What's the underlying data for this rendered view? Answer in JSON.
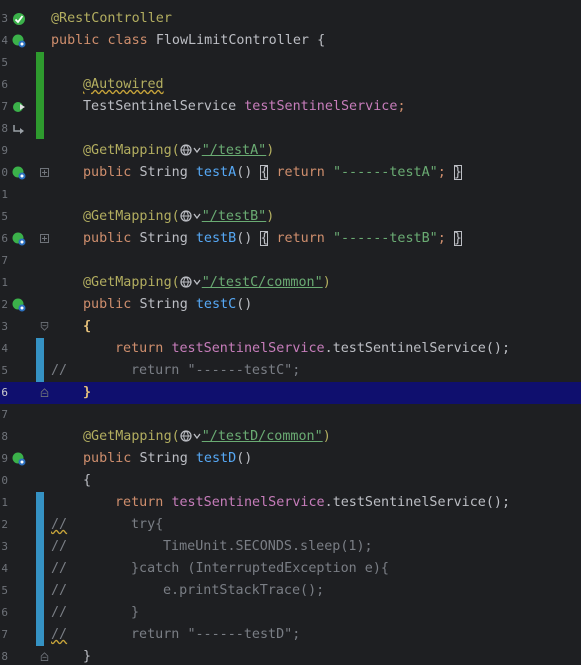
{
  "gutter": {
    "line_number_fragments": [
      "3",
      "4",
      "5",
      "6",
      "7",
      "8",
      "9",
      "0",
      "1",
      "5",
      "6",
      "7",
      "1",
      "2",
      "3",
      "4",
      "5",
      "6",
      "7",
      "8",
      "9",
      "0",
      "1",
      "2",
      "3",
      "4",
      "5",
      "6",
      "7",
      "8"
    ]
  },
  "code": {
    "rest_controller": "@RestController",
    "public": "public",
    "class": "class",
    "class_name": "FlowLimitController",
    "open_brace": "{",
    "close_brace": "}",
    "autowired": "@Autowired",
    "service_type": "TestSentinelService",
    "service_field": "testSentinelService",
    "semicolon": ";",
    "get_mapping": "@GetMapping(",
    "close_paren": ")",
    "string_type": "String",
    "return": "return",
    "paren_pair": "()",
    "test_a": {
      "path": "\"/testA\"",
      "method": "testA",
      "ret": "\"------testA\""
    },
    "test_b": {
      "path": "\"/testB\"",
      "method": "testB",
      "ret": "\"------testB\""
    },
    "test_c": {
      "path": "\"/testC/common\"",
      "method": "testC",
      "commented_ret": "\"------testC\""
    },
    "test_d": {
      "path": "\"/testD/common\"",
      "method": "testD",
      "commented_ret": "\"------testD\""
    },
    "call_method": "testSentinelService",
    "call_tail": "();",
    "comment_prefix": "//",
    "try_open": "try{",
    "sleep_call": "TimeUnit.SECONDS.sleep(1);",
    "catch_line": "}catch (InterruptedException e){",
    "print_stack": "e.printStackTrace();",
    "brace_close": "}"
  },
  "colors": {
    "background": "#1e1f22",
    "current_line": "#0f0f6e",
    "annotation": "#b3ae60",
    "keyword": "#cf8e6d",
    "string": "#6aab73",
    "field": "#c77dbb",
    "method": "#56a8f5",
    "comment": "#7a7e85",
    "vcs_added": "#2e9a2e",
    "vcs_modified": "#3592c4"
  }
}
